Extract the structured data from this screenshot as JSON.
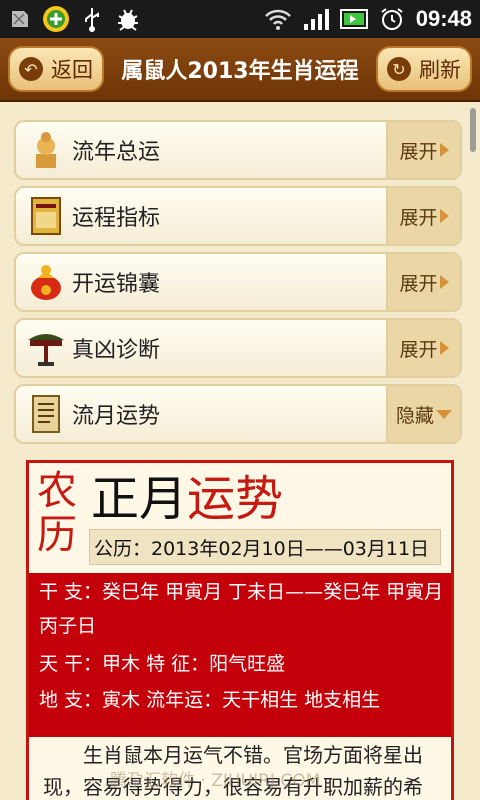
{
  "status_bar": {
    "time": "09:48",
    "icons": [
      "sd-card-icon",
      "app-plus-icon",
      "usb-icon",
      "debug-bug-icon",
      "wifi-icon",
      "signal-icon",
      "battery-icon",
      "alarm-icon"
    ]
  },
  "header": {
    "back_label": "返回",
    "title": "属鼠人2013年生肖运程",
    "refresh_label": "刷新"
  },
  "sections": [
    {
      "label": "流年总运",
      "toggle": "展开"
    },
    {
      "label": "运程指标",
      "toggle": "展开"
    },
    {
      "label": "开运锦囊",
      "toggle": "展开"
    },
    {
      "label": "真凶诊断",
      "toggle": "展开"
    },
    {
      "label": "流月运势",
      "toggle": "隐藏"
    }
  ],
  "detail": {
    "nongli": "农历",
    "month": "正月",
    "fortune": "运势",
    "gongli": "公历：2013年02月10日——03月11日",
    "ganzhi": "干 支：癸巳年 甲寅月 丁未日——癸巳年 甲寅月 丙子日",
    "tiangan": "天 干：甲木 特 征：阳气旺盛",
    "dizhi": "地 支：寅木 流年运：天干相生 地支相生",
    "paragraph": "生肖鼠本月运气不错。官场方面将星出现，容易得势得力，很容易有升职加薪的希"
  },
  "watermark": "腾尕汇软件 · ZIHUIRJ.COM",
  "colors": {
    "header": "#7a3c0a",
    "accent_red": "#c4000a",
    "panel_bg": "#f5ebcc"
  }
}
